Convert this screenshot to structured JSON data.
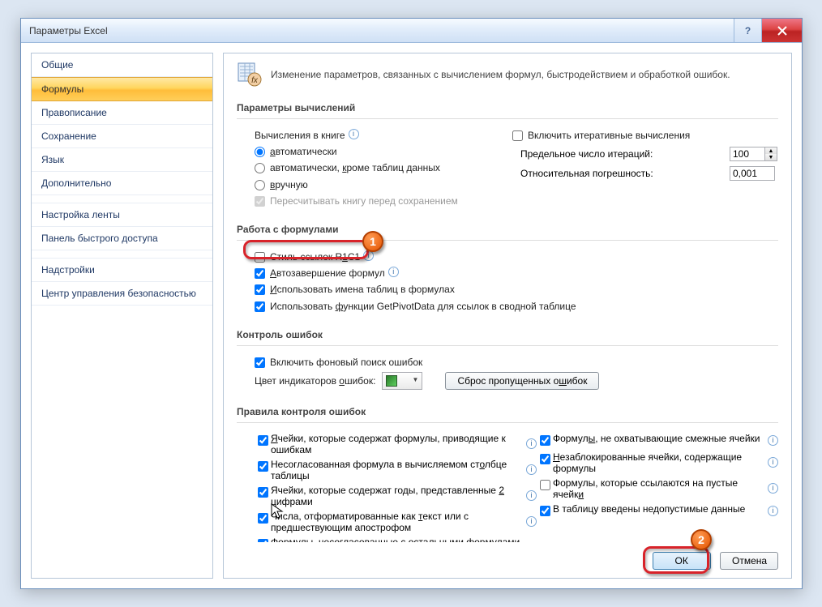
{
  "window": {
    "title": "Параметры Excel"
  },
  "sidebar": {
    "items": [
      "Общие",
      "Формулы",
      "Правописание",
      "Сохранение",
      "Язык",
      "Дополнительно",
      "Настройка ленты",
      "Панель быстрого доступа",
      "Надстройки",
      "Центр управления безопасностью"
    ],
    "selected": 1
  },
  "heading": "Изменение параметров, связанных с вычислением формул, быстродействием и обработкой ошибок.",
  "calc": {
    "title": "Параметры вычислений",
    "left": {
      "label": "Вычисления в книге",
      "opts": {
        "auto": "автоматически",
        "auto_ex": "автоматически, кроме таблиц данных",
        "manual": "вручную"
      },
      "recalc": "Пересчитывать книгу перед сохранением"
    },
    "right": {
      "iter_enable": "Включить итеративные вычисления",
      "iter_max_lbl": "Предельное число итераций:",
      "iter_max_val": "100",
      "iter_tol_lbl": "Относительная погрешность:",
      "iter_tol_val": "0,001"
    }
  },
  "formulas": {
    "title": "Работа с формулами",
    "r1c1": "Стиль ссылок R1C1",
    "autocomplete": "Автозавершение формул",
    "table_names": "Использовать имена таблиц в формулах",
    "pivot": "Использовать функции GetPivotData для ссылок в сводной таблице"
  },
  "errchk": {
    "title": "Контроль ошибок",
    "enable": "Включить фоновый поиск ошибок",
    "color_lbl": "Цвет индикаторов ошибок:",
    "reset_btn": "Сброс пропущенных ошибок"
  },
  "rules": {
    "title": "Правила контроля ошибок",
    "left": [
      "Ячейки, которые содержат формулы, приводящие к ошибкам",
      "Несогласованная формула в вычисляемом столбце таблицы",
      "Ячейки, которые содержат годы, представленные 2 цифрами",
      "Числа, отформатированные как текст или с предшествующим апострофом",
      "Формулы, несогласованные с остальными формулами в области"
    ],
    "right": [
      "Формулы, не охватывающие смежные ячейки",
      "Незаблокированные ячейки, содержащие формулы",
      "Формулы, которые ссылаются на пустые ячейки",
      "В таблицу введены недопустимые данные"
    ],
    "right_checked": [
      true,
      true,
      false,
      true
    ]
  },
  "buttons": {
    "ok": "ОК",
    "cancel": "Отмена"
  },
  "annotations": {
    "b1": "1",
    "b2": "2"
  }
}
